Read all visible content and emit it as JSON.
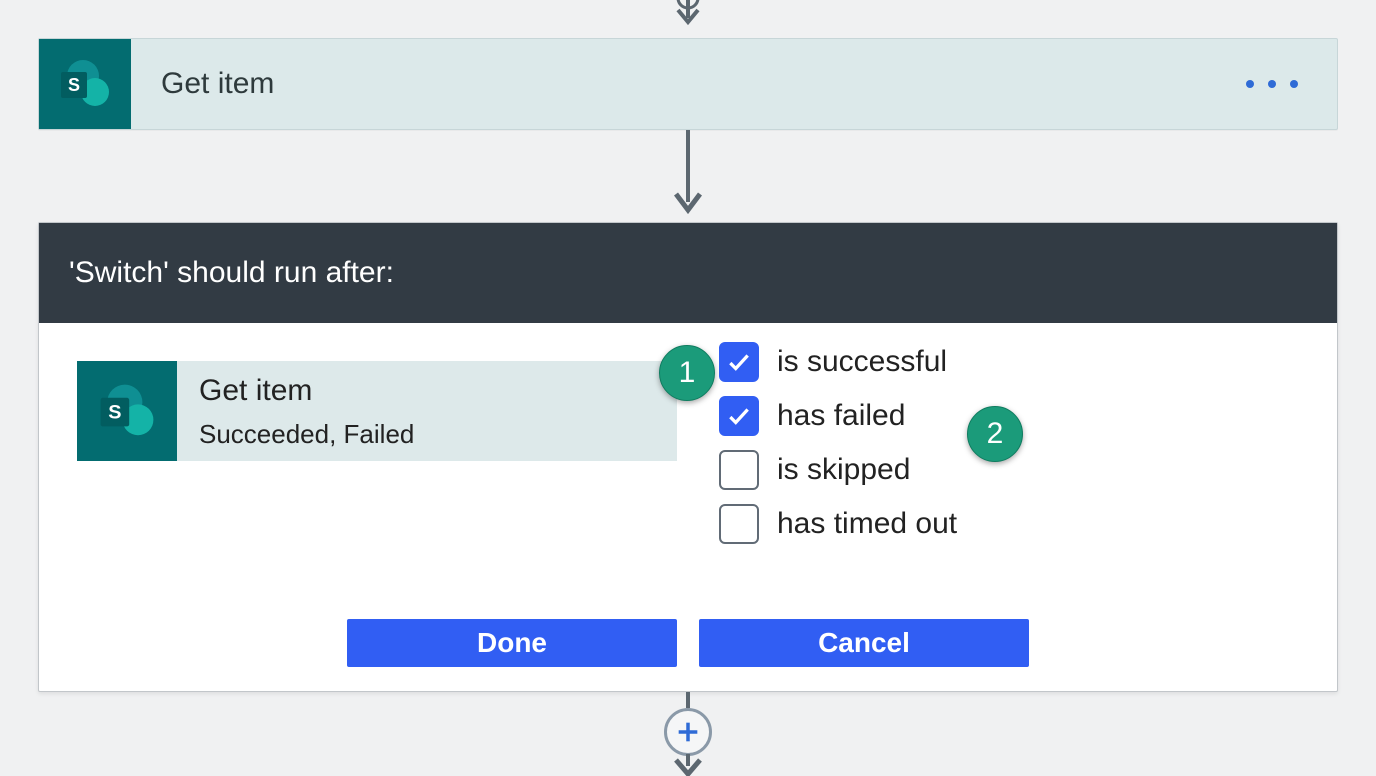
{
  "action": {
    "title": "Get item",
    "icon_name": "sharepoint-icon"
  },
  "panel": {
    "header": "'Switch' should run after:",
    "ref": {
      "title": "Get item",
      "status_summary": "Succeeded, Failed",
      "icon_name": "sharepoint-icon"
    },
    "options": [
      {
        "label": "is successful",
        "checked": true
      },
      {
        "label": "has failed",
        "checked": true
      },
      {
        "label": "is skipped",
        "checked": false
      },
      {
        "label": "has timed out",
        "checked": false
      }
    ],
    "buttons": {
      "done": "Done",
      "cancel": "Cancel"
    }
  },
  "annotations": {
    "badge1": "1",
    "badge2": "2"
  },
  "colors": {
    "teal": "#036c70",
    "teal_light": "#1b9b7a",
    "header_dark": "#323b44",
    "primary_blue": "#315ef3",
    "card_bg": "#dce9ea"
  }
}
